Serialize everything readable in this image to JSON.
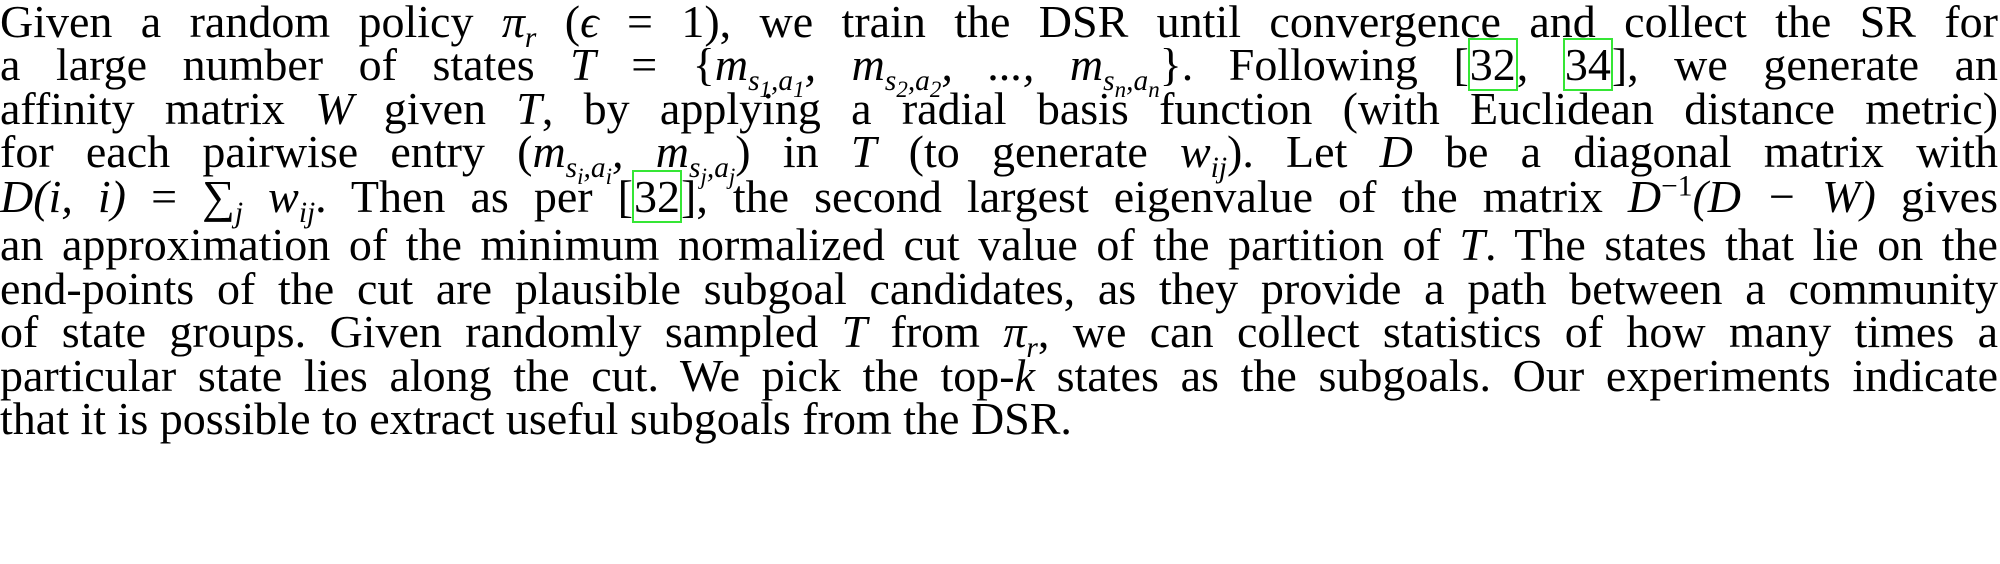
{
  "paragraph": {
    "l1": {
      "a": "Given a random policy ",
      "pi": "π",
      "r": "r",
      "b": " (",
      "eps": "ϵ",
      "eq": " = 1",
      "c": "), we train the DSR until convergence and collect the SR for"
    },
    "l2": {
      "a": "a large number of states ",
      "T": "T",
      "eq": " = {",
      "m": "m",
      "s1a1": "s",
      "i1": "1",
      "a1": ",a",
      "j1": "1",
      "sep1": ", ",
      "m2": "m",
      "s2": "s",
      "i2": "2",
      "a2": ",a",
      "j2": "2",
      "dots": ", ..., ",
      "m3": "m",
      "sn": "s",
      "in": "n",
      "an": ",a",
      "jn": "n",
      "close": "}",
      "b": ". Following [",
      "c1": "32",
      "comma": ", ",
      "c2": "34",
      "c": "], we generate an"
    },
    "l3": {
      "a": "affinity matrix ",
      "W": "W",
      "b": " given ",
      "T": "T",
      "c": ", by applying a radial basis function (with Euclidean distance metric)"
    },
    "l4": {
      "a": "for each pairwise entry (",
      "m1": "m",
      "s1": "s",
      "i1": "i",
      "a1": ",a",
      "j1": "i",
      "sep": ", ",
      "m2": "m",
      "s2": "s",
      "i2": "j",
      "a2": ",a",
      "j2": "j",
      "b": ") in ",
      "T": "T",
      "c": " (to generate ",
      "w": "w",
      "ij": "ij",
      "d": "). Let ",
      "D": "D",
      "e": " be a diagonal matrix with"
    },
    "l5": {
      "D": "D",
      "arg": "(i, i)",
      "eq": " = ",
      "sum": "∑",
      "j": "j",
      "w": " w",
      "ij": "ij",
      "a": ". Then as per [",
      "c1": "32",
      "b": "], the second largest eigenvalue of the matrix ",
      "Dinv": "D",
      "exp": "−1",
      "expr": "(D − W)",
      "c": " gives"
    },
    "l6": {
      "a": "an approximation of the minimum normalized cut value of the partition of ",
      "T": "T",
      "b": ". The states that lie on the"
    },
    "l7": "end-points of the cut are plausible subgoal candidates, as they provide a path between a community",
    "l8": {
      "a": "of state groups. Given randomly sampled ",
      "T": "T",
      "b": " from ",
      "pi": "π",
      "r": "r",
      "c": ", we can collect statistics of how many times a"
    },
    "l9": {
      "a": "particular state lies along the cut. We pick the top-",
      "k": "k",
      "b": " states as the subgoals. Our experiments indicate"
    },
    "l10": "that it is possible to extract useful subgoals from the DSR."
  }
}
